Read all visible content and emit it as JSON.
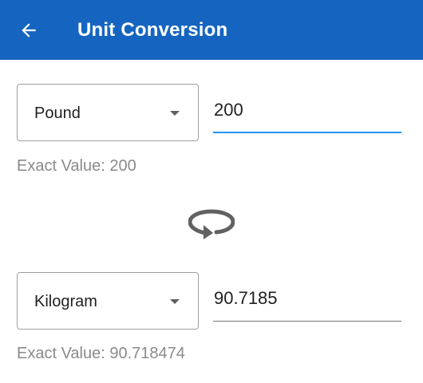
{
  "header": {
    "title": "Unit Conversion",
    "back_icon": "arrow-back-icon",
    "background_color": "#1565c0"
  },
  "from": {
    "unit": "Pound",
    "value": "200",
    "exact_value": "Exact Value: 200",
    "dropdown_icon": "dropdown-arrow-icon"
  },
  "swap": {
    "icon": "swap-rotate-icon"
  },
  "to": {
    "unit": "Kilogram",
    "value": "90.7185",
    "exact_value": "Exact Value: 90.718474",
    "dropdown_icon": "dropdown-arrow-icon"
  },
  "colors": {
    "accent": "#2196f3",
    "secondary_text": "#8a8a8a"
  }
}
